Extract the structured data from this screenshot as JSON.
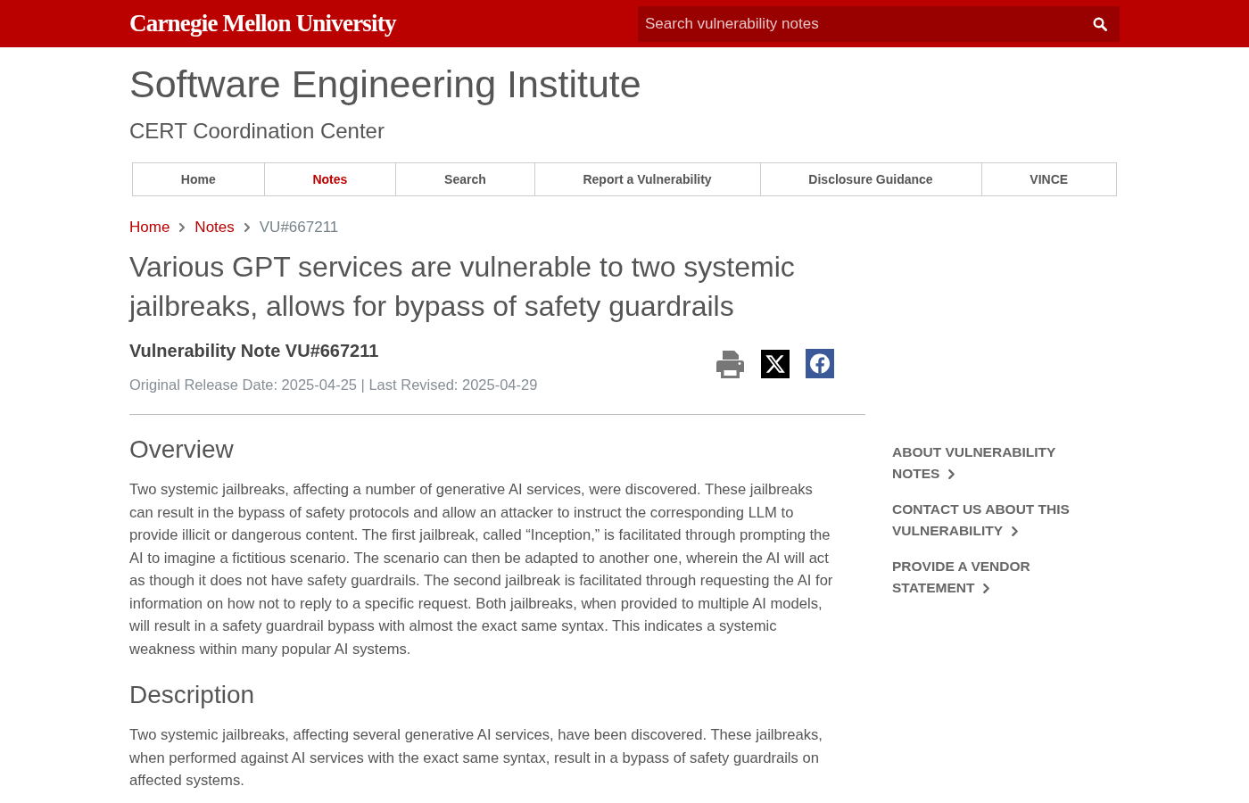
{
  "header": {
    "logo": "Carnegie Mellon University",
    "search": {
      "placeholder": "Search vulnerability notes"
    }
  },
  "site": {
    "title": "Software Engineering Institute",
    "subtitle": "CERT Coordination Center"
  },
  "nav": [
    {
      "label": "Home",
      "selected": false
    },
    {
      "label": "Notes",
      "selected": true
    },
    {
      "label": "Search",
      "selected": false
    },
    {
      "label": "Report a Vulnerability",
      "selected": false
    },
    {
      "label": "Disclosure Guidance",
      "selected": false
    },
    {
      "label": "VINCE",
      "selected": false
    }
  ],
  "breadcrumb": [
    {
      "label": "Home",
      "kind": "link"
    },
    {
      "label": "Notes",
      "kind": "link"
    },
    {
      "label": "VU#667211",
      "kind": "current"
    }
  ],
  "note": {
    "title": "Various GPT services are vulnerable to two systemic jailbreaks, allows for bypass of safety guardrails",
    "heading": "Vulnerability Note VU#667211",
    "dates": "Original Release Date: 2025-04-25 | Last Revised: 2025-04-29"
  },
  "sections": [
    {
      "heading": "Overview",
      "text": "Two systemic jailbreaks, affecting a number of generative AI services, were discovered. These jailbreaks can result in the bypass of safety protocols and allow an attacker to instruct the corresponding LLM to provide illicit or dangerous content. The first jailbreak, called “Inception,” is facilitated through prompting the AI to imagine a fictitious scenario. The scenario can then be adapted to another one, wherein the AI will act as though it does not have safety guardrails. The second jailbreak is facilitated through requesting the AI for information on how not to reply to a specific request. Both jailbreaks, when provided to multiple AI models, will result in a safety guardrail bypass with almost the exact same syntax. This indicates a systemic weakness within many popular AI systems."
    },
    {
      "heading": "Description",
      "text": "Two systemic jailbreaks, affecting several generative AI services, have been discovered. These jailbreaks, when performed against AI services with the exact same syntax, result in a bypass of safety guardrails on affected systems."
    }
  ],
  "sidebar": {
    "links": [
      "ABOUT VULNERABILITY NOTES",
      "CONTACT US ABOUT THIS VULNERABILITY",
      "PROVIDE A VENDOR STATEMENT"
    ]
  }
}
